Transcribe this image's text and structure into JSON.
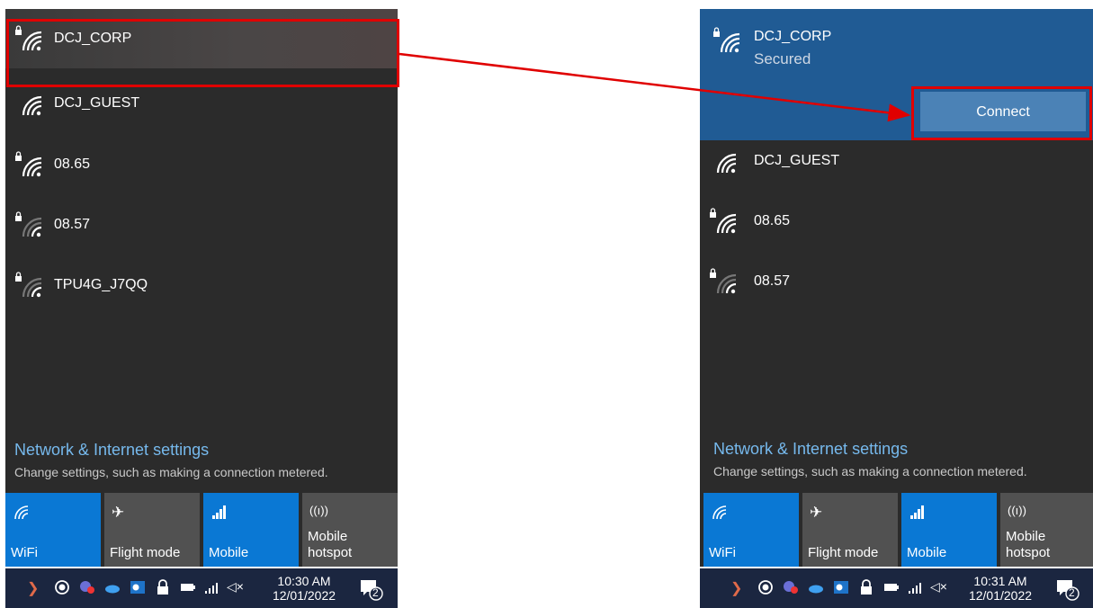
{
  "left": {
    "networks": [
      {
        "name": "DCJ_CORP",
        "secured": true,
        "signal": "full"
      },
      {
        "name": "DCJ_GUEST",
        "secured": false,
        "signal": "full"
      },
      {
        "name": "08.65",
        "secured": true,
        "signal": "full"
      },
      {
        "name": "08.57",
        "secured": true,
        "signal": "weak"
      },
      {
        "name": "TPU4G_J7QQ",
        "secured": true,
        "signal": "weak"
      }
    ],
    "settings_link": "Network & Internet settings",
    "settings_desc": "Change settings, such as making a connection metered.",
    "tiles": [
      {
        "label": "WiFi",
        "icon": "wifi-icon",
        "on": true
      },
      {
        "label": "Flight mode",
        "icon": "airplane-icon",
        "on": false
      },
      {
        "label": "Mobile",
        "icon": "cellular-icon",
        "on": true
      },
      {
        "label": "Mobile\nhotspot",
        "icon": "hotspot-icon",
        "on": false
      }
    ],
    "clock": {
      "time": "10:30 AM",
      "date": "12/01/2022"
    },
    "notification_count": "2"
  },
  "right": {
    "selected": {
      "name": "DCJ_CORP",
      "status": "Secured",
      "connect_label": "Connect"
    },
    "networks": [
      {
        "name": "DCJ_GUEST",
        "secured": false,
        "signal": "full"
      },
      {
        "name": "08.65",
        "secured": true,
        "signal": "full"
      },
      {
        "name": "08.57",
        "secured": true,
        "signal": "weak"
      }
    ],
    "settings_link": "Network & Internet settings",
    "settings_desc": "Change settings, such as making a connection metered.",
    "tiles": [
      {
        "label": "WiFi",
        "icon": "wifi-icon",
        "on": true
      },
      {
        "label": "Flight mode",
        "icon": "airplane-icon",
        "on": false
      },
      {
        "label": "Mobile",
        "icon": "cellular-icon",
        "on": true
      },
      {
        "label": "Mobile\nhotspot",
        "icon": "hotspot-icon",
        "on": false
      }
    ],
    "clock": {
      "time": "10:31 AM",
      "date": "12/01/2022"
    },
    "notification_count": "2"
  },
  "colors": {
    "accent": "#0a78d4",
    "selected_row": "#205b94",
    "link": "#76b9ed",
    "annotation": "#e00000",
    "taskbar": "#1b2640"
  }
}
